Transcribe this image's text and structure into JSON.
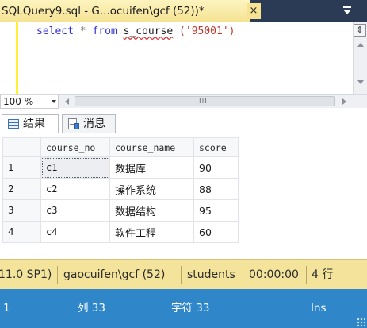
{
  "window": {
    "tab_title": "SQLQuery9.sql - G...ocuifen\\gcf (52))*",
    "tab_close_glyph": "×"
  },
  "editor": {
    "code": {
      "keyword_select": "select",
      "star": "*",
      "keyword_from": "from",
      "table": "s_course",
      "argument": "('95001')"
    },
    "split_button_glyph": "⇕"
  },
  "zoom": {
    "value": "100 %",
    "scroll_grip": "III"
  },
  "results_tabs": [
    {
      "label": "结果",
      "icon": "grid-icon",
      "active": true
    },
    {
      "label": "消息",
      "icon": "messages-icon",
      "active": false
    }
  ],
  "results": {
    "columns": [
      "course_no",
      "course_name",
      "score"
    ],
    "rows": [
      {
        "row_number": "1",
        "course_no": "c1",
        "course_name": "数据库",
        "score": "90"
      },
      {
        "row_number": "2",
        "course_no": "c2",
        "course_name": "操作系统",
        "score": "88"
      },
      {
        "row_number": "3",
        "course_no": "c3",
        "course_name": "数据结构",
        "score": "95"
      },
      {
        "row_number": "4",
        "course_no": "c4",
        "course_name": "软件工程",
        "score": "60"
      }
    ]
  },
  "connection_status": {
    "server_version": "11.0 SP1)",
    "user": "gaocuifen\\gcf (52)",
    "database": "students",
    "elapsed": "00:00:00",
    "rows": "4 行"
  },
  "status_bar": {
    "line": "1",
    "column": "列 33",
    "char": "字符 33",
    "mode": "Ins"
  },
  "colors": {
    "tab_active": "#f5e292",
    "title_bar": "#2b3a55",
    "keyword": "#2f2fd6",
    "string": "#c0392b",
    "connection_bar": "#f3e39b",
    "status_bar": "#2f86c8"
  }
}
